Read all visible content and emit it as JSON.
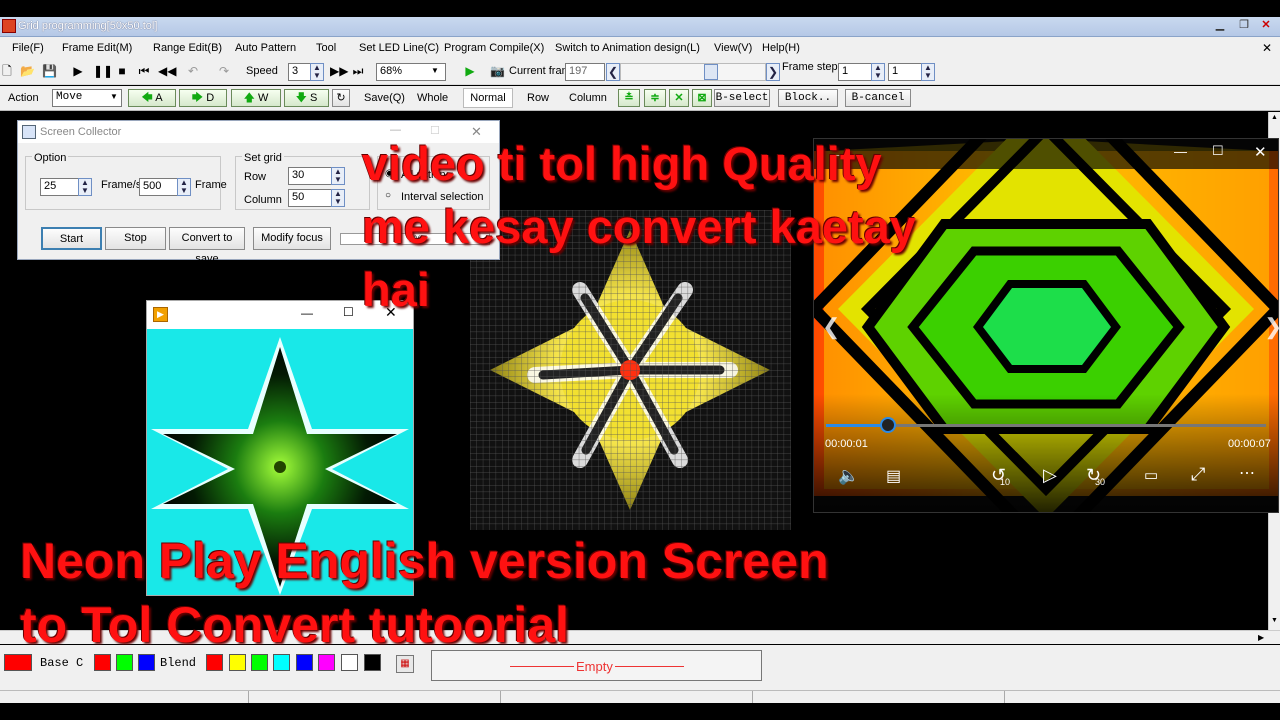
{
  "window": {
    "title": "Grid programming[50x50.tol]"
  },
  "menu": [
    "File(F)",
    "Frame Edit(M)",
    "Range Edit(B)",
    "Auto Pattern",
    "Tool",
    "Set LED Line(C)",
    "Program Compile(X)",
    "Switch to Animation design(L)",
    "View(V)",
    "Help(H)"
  ],
  "toolbar1": {
    "speed_label": "Speed",
    "speed_value": "3",
    "zoom_value": "68%",
    "current_frame_label": "Current frame",
    "current_frame_value": "197",
    "frame_step_label": "Frame step",
    "frame_step_value": "1",
    "frame_step_value2": "1"
  },
  "toolbar2": {
    "action_label": "Action",
    "action_value": "Move",
    "arrows": [
      "A",
      "D",
      "W",
      "S"
    ],
    "save_label": "Save(Q)",
    "whole_label": "Whole",
    "normal_label": "Normal",
    "row_label": "Row",
    "column_label": "Column",
    "bselect_label": "B-select",
    "block_label": "Block..",
    "bcancel_label": "B-cancel"
  },
  "collector": {
    "title": "Screen Collector",
    "option_label": "Option",
    "fps_value": "25",
    "fps_unit": "Frame/s",
    "frames_value": "500",
    "frames_unit": "Frame",
    "setgrid_label": "Set grid",
    "row_label": "Row",
    "row_value": "30",
    "column_label": "Column",
    "column_value": "50",
    "radio1": "All action",
    "radio2": "Interval selection",
    "btn_start": "Start",
    "btn_stop": "Stop",
    "btn_convert": "Convert to save",
    "btn_modify": "Modify focus",
    "progress_text": "0%"
  },
  "movie": {
    "time_elapsed": "00:00:01",
    "time_total": "00:00:07",
    "progress": 0.14,
    "skip_back": "10",
    "skip_forward": "30"
  },
  "overlay": {
    "line1": "video ti tol high Quality",
    "line2": "me kesay convert kaetay",
    "line3": "hai",
    "line4": "Neon Play English  version Screen",
    "line5": "to Tol Convert tutoorial"
  },
  "palette": {
    "base_label": "Base C",
    "blend_label": "Blend",
    "empty_label": "Empty",
    "colors": {
      "base": "#ff0000",
      "base_set": [
        "#ff0000",
        "#00ff00",
        "#0000ff"
      ],
      "blend_set": [
        "#ff0000",
        "#ffff00",
        "#00ff00",
        "#00ffff",
        "#0000ff",
        "#ff00ff",
        "#ffffff",
        "#000000"
      ]
    }
  }
}
